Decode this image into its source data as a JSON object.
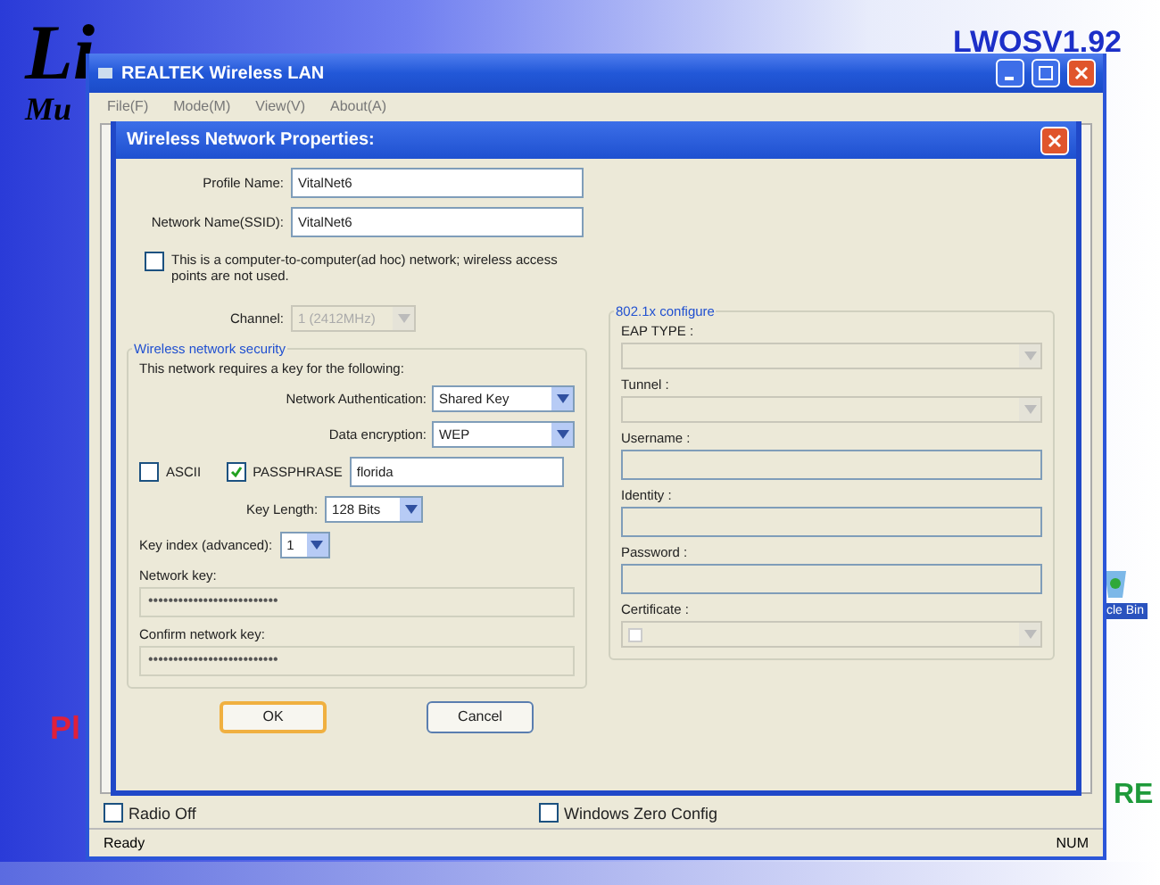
{
  "slide": {
    "title": "Li",
    "subtitle": "Mu",
    "version": "LWOSV1.92",
    "left_fragment": "Pl",
    "right_fragment": "RE",
    "desktop_icon_label": "cle Bin"
  },
  "main_window": {
    "title": "REALTEK Wireless LAN",
    "menu": [
      "File(F)",
      "Mode(M)",
      "View(V)",
      "About(A)"
    ],
    "checkboxes": [
      {
        "label": "Radio Off",
        "checked": false
      },
      {
        "label": "Windows Zero Config",
        "checked": false
      }
    ],
    "status_bar": [
      "Ready",
      "NUM"
    ]
  },
  "dialog": {
    "title": "Wireless Network Properties:",
    "fields": [
      {
        "label": "Profile Name:",
        "value": "VitalNet6"
      },
      {
        "label": "Network Name(SSID):",
        "value": "VitalNet6"
      }
    ],
    "adhoc": {
      "label": "This is a computer-to-computer(ad hoc) network; wireless access points are not used.",
      "checked": false
    },
    "channel": {
      "label": "Channel:",
      "value": "1 (2412MHz)",
      "disabled": true
    },
    "security": {
      "legend": "Wireless network security",
      "intro": "This network requires a key for the following:",
      "selects": [
        {
          "label": "Network Authentication:",
          "value": "Shared Key"
        },
        {
          "label": "Data encryption:",
          "value": "WEP"
        }
      ],
      "ascii": {
        "label": "ASCII",
        "checked": false
      },
      "passphrase": {
        "label": "PASSPHRASE",
        "checked": true,
        "value": "florida"
      },
      "key_length": {
        "label": "Key Length:",
        "value": "128 Bits"
      },
      "key_index": {
        "label": "Key index (advanced):",
        "value": "1"
      },
      "keys": [
        {
          "label": "Network key:",
          "value": "••••••••••••••••••••••••••",
          "disabled": true
        },
        {
          "label": "Confirm network key:",
          "value": "••••••••••••••••••••••••••",
          "disabled": true
        }
      ]
    },
    "dot1x": {
      "legend": "802.1x configure",
      "rows": [
        {
          "kind": "select",
          "label": "EAP TYPE :",
          "disabled": true
        },
        {
          "kind": "select",
          "label": "Tunnel :",
          "disabled": true
        },
        {
          "kind": "input",
          "label": "Username :",
          "disabled": true
        },
        {
          "kind": "input",
          "label": "Identity :",
          "disabled": true
        },
        {
          "kind": "input",
          "label": "Password :",
          "disabled": true
        },
        {
          "kind": "certificate",
          "label": "Certificate :",
          "disabled": true
        }
      ]
    },
    "buttons": [
      {
        "label": "OK",
        "default": true
      },
      {
        "label": "Cancel",
        "default": false
      }
    ]
  }
}
